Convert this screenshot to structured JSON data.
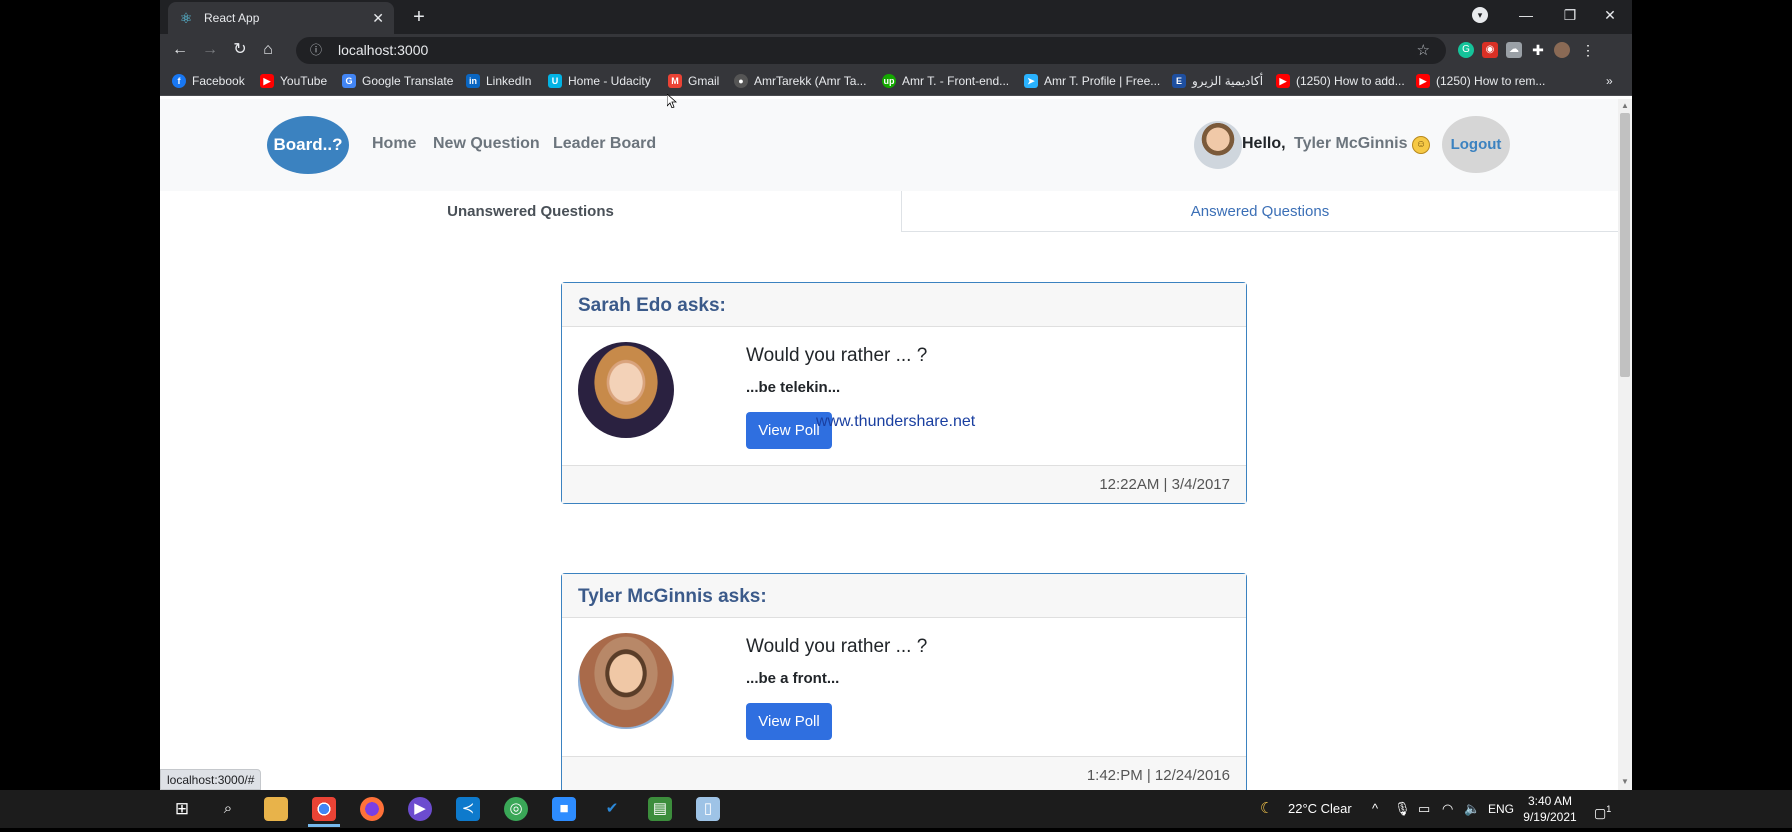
{
  "browser": {
    "tab_title": "React App",
    "url": "localhost:3000",
    "status_url": "localhost:3000/#",
    "bookmarks": [
      {
        "label": "Facebook",
        "icon": "facebook-icon",
        "color": "#1877f2"
      },
      {
        "label": "YouTube",
        "icon": "youtube-icon",
        "color": "#ff0000"
      },
      {
        "label": "Google Translate",
        "icon": "translate-icon",
        "color": "#4285f4"
      },
      {
        "label": "LinkedIn",
        "icon": "linkedin-icon",
        "color": "#0a66c2"
      },
      {
        "label": "Home - Udacity",
        "icon": "udacity-icon",
        "color": "#02b3e4"
      },
      {
        "label": "Gmail",
        "icon": "gmail-icon",
        "color": "#ea4335"
      },
      {
        "label": "AmrTarekk (Amr Ta...",
        "icon": "github-icon",
        "color": "#24292e"
      },
      {
        "label": "Amr T. - Front-end...",
        "icon": "upwork-icon",
        "color": "#14a800"
      },
      {
        "label": "Amr T. Profile | Free...",
        "icon": "freelancer-icon",
        "color": "#29b2fe"
      },
      {
        "label": "أكاديمية الزيرو",
        "icon": "academy-icon",
        "color": "#1e4fa0"
      },
      {
        "label": "(1250) How to add...",
        "icon": "youtube-icon",
        "color": "#ff0000"
      },
      {
        "label": "(1250) How to rem...",
        "icon": "youtube-icon",
        "color": "#ff0000"
      }
    ]
  },
  "app": {
    "brand": "Board..?",
    "nav": [
      "Home",
      "New Question",
      "Leader Board"
    ],
    "greeting": "Hello,",
    "user_name": "Tyler McGinnis",
    "logout": "Logout",
    "tabs": {
      "unanswered": "Unanswered Questions",
      "answered": "Answered Questions"
    },
    "questions": [
      {
        "author": "Sarah Edo asks:",
        "prompt": "Would you rather ... ?",
        "option": "...be telekin...",
        "button": "View Poll",
        "timestamp": "12:22AM | 3/4/2017"
      },
      {
        "author": "Tyler McGinnis asks:",
        "prompt": "Would you rather ... ?",
        "option": "...be a front...",
        "button": "View Poll",
        "timestamp": "1:42:PM | 12/24/2016"
      }
    ],
    "watermark": "www.thundershare.net",
    "accent_color": "#3b82c0",
    "button_color": "#2f6fe0"
  },
  "taskbar": {
    "weather": "22°C  Clear",
    "language": "ENG",
    "time": "3:40 AM",
    "date": "9/19/2021",
    "notification_count": "1"
  }
}
